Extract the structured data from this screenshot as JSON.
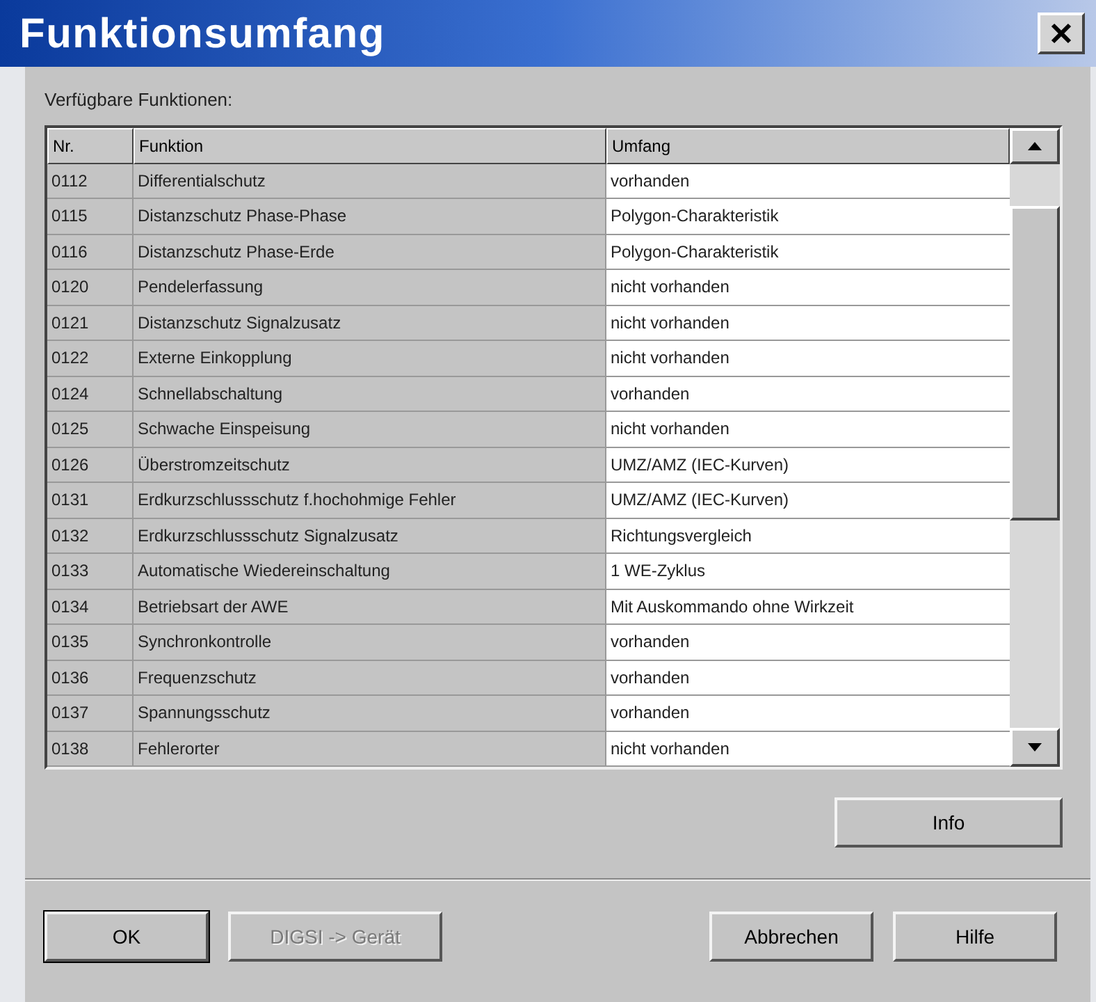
{
  "window": {
    "title": "Funktionsumfang"
  },
  "list_label": "Verfügbare Funktionen:",
  "table": {
    "columns": [
      "Nr.",
      "Funktion",
      "Umfang"
    ],
    "rows": [
      [
        "0112",
        "Differentialschutz",
        "vorhanden"
      ],
      [
        "0115",
        "Distanzschutz Phase-Phase",
        "Polygon-Charakteristik"
      ],
      [
        "0116",
        "Distanzschutz Phase-Erde",
        "Polygon-Charakteristik"
      ],
      [
        "0120",
        "Pendelerfassung",
        "nicht vorhanden"
      ],
      [
        "0121",
        "Distanzschutz Signalzusatz",
        "nicht vorhanden"
      ],
      [
        "0122",
        "Externe Einkopplung",
        "nicht vorhanden"
      ],
      [
        "0124",
        "Schnellabschaltung",
        "vorhanden"
      ],
      [
        "0125",
        "Schwache Einspeisung",
        "nicht vorhanden"
      ],
      [
        "0126",
        "Überstromzeitschutz",
        "UMZ/AMZ (IEC-Kurven)"
      ],
      [
        "0131",
        "Erdkurzschlussschutz f.hochohmige Fehler",
        "UMZ/AMZ (IEC-Kurven)"
      ],
      [
        "0132",
        "Erdkurzschlussschutz Signalzusatz",
        "Richtungsvergleich"
      ],
      [
        "0133",
        "Automatische Wiedereinschaltung",
        "1 WE-Zyklus"
      ],
      [
        "0134",
        "Betriebsart der AWE",
        "Mit Auskommando ohne Wirkzeit"
      ],
      [
        "0135",
        "Synchronkontrolle",
        "vorhanden"
      ],
      [
        "0136",
        "Frequenzschutz",
        "vorhanden"
      ],
      [
        "0137",
        "Spannungsschutz",
        "vorhanden"
      ],
      [
        "0138",
        "Fehlerorter",
        "nicht vorhanden"
      ]
    ]
  },
  "info_button": {
    "label": "Info",
    "disabled": false
  },
  "buttons": [
    {
      "label": "OK",
      "disabled": false,
      "default": true
    },
    {
      "label": "DIGSI -> Gerät",
      "disabled": true,
      "default": false
    },
    {
      "label": "Abbrechen",
      "disabled": false,
      "default": false
    },
    {
      "label": "Hilfe",
      "disabled": false,
      "default": false
    }
  ]
}
